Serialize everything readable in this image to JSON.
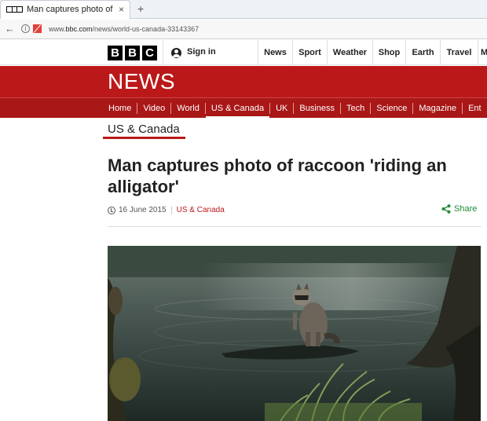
{
  "browser": {
    "tab_title": "Man captures photo of rac…",
    "tab_close": "×",
    "new_tab": "+",
    "back": "←",
    "url_prefix": "www.",
    "url_domain": "bbc.com",
    "url_path": "/news/world-us-canada-33143367"
  },
  "bbc": {
    "logo_letters": [
      "B",
      "B",
      "C"
    ],
    "signin_label": "Sign in",
    "topnav": [
      "News",
      "Sport",
      "Weather",
      "Shop",
      "Earth",
      "Travel",
      "M"
    ]
  },
  "news": {
    "banner_title": "NEWS",
    "section_nav": [
      "Home",
      "Video",
      "World",
      "US & Canada",
      "UK",
      "Business",
      "Tech",
      "Science",
      "Magazine",
      "Ent"
    ],
    "active_section": "US & Canada"
  },
  "article": {
    "section_heading": "US & Canada",
    "headline": "Man captures photo of raccoon 'riding an alligator'",
    "date": "16 June 2015",
    "section_link": "US & Canada",
    "share_label": "Share",
    "image_alt": "raccoon standing on alligator in water"
  },
  "colors": {
    "bbc_red": "#bb1919",
    "nav_red": "#a91717",
    "share_green": "#1f8a36"
  }
}
